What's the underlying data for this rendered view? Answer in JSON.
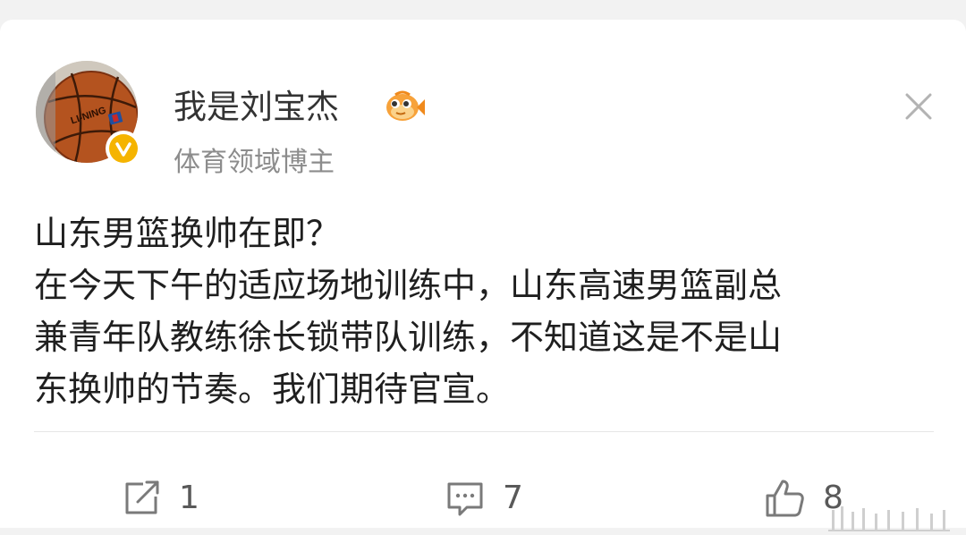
{
  "post": {
    "author": {
      "name": "我是刘宝杰",
      "subtitle": "体育领域博主",
      "avatar_icon": "basketball-avatar",
      "badge_icon": "verified-badge-icon",
      "badge_color": "#f5b400"
    },
    "body_lines": [
      "山东男篮换帅在即？",
      "在今天下午的适应场地训练中，山东高速男篮副总",
      "兼青年队教练徐长锁带队训练，不知道这是不是山",
      "东换帅的节奏。我们期待官宣。"
    ],
    "actions": {
      "repost_count": "1",
      "comment_count": "7",
      "like_count": "8"
    }
  },
  "colors": {
    "background": "#f2f2f2",
    "card": "#ffffff",
    "text": "#1f1f1f",
    "muted": "#8c8c8c"
  }
}
